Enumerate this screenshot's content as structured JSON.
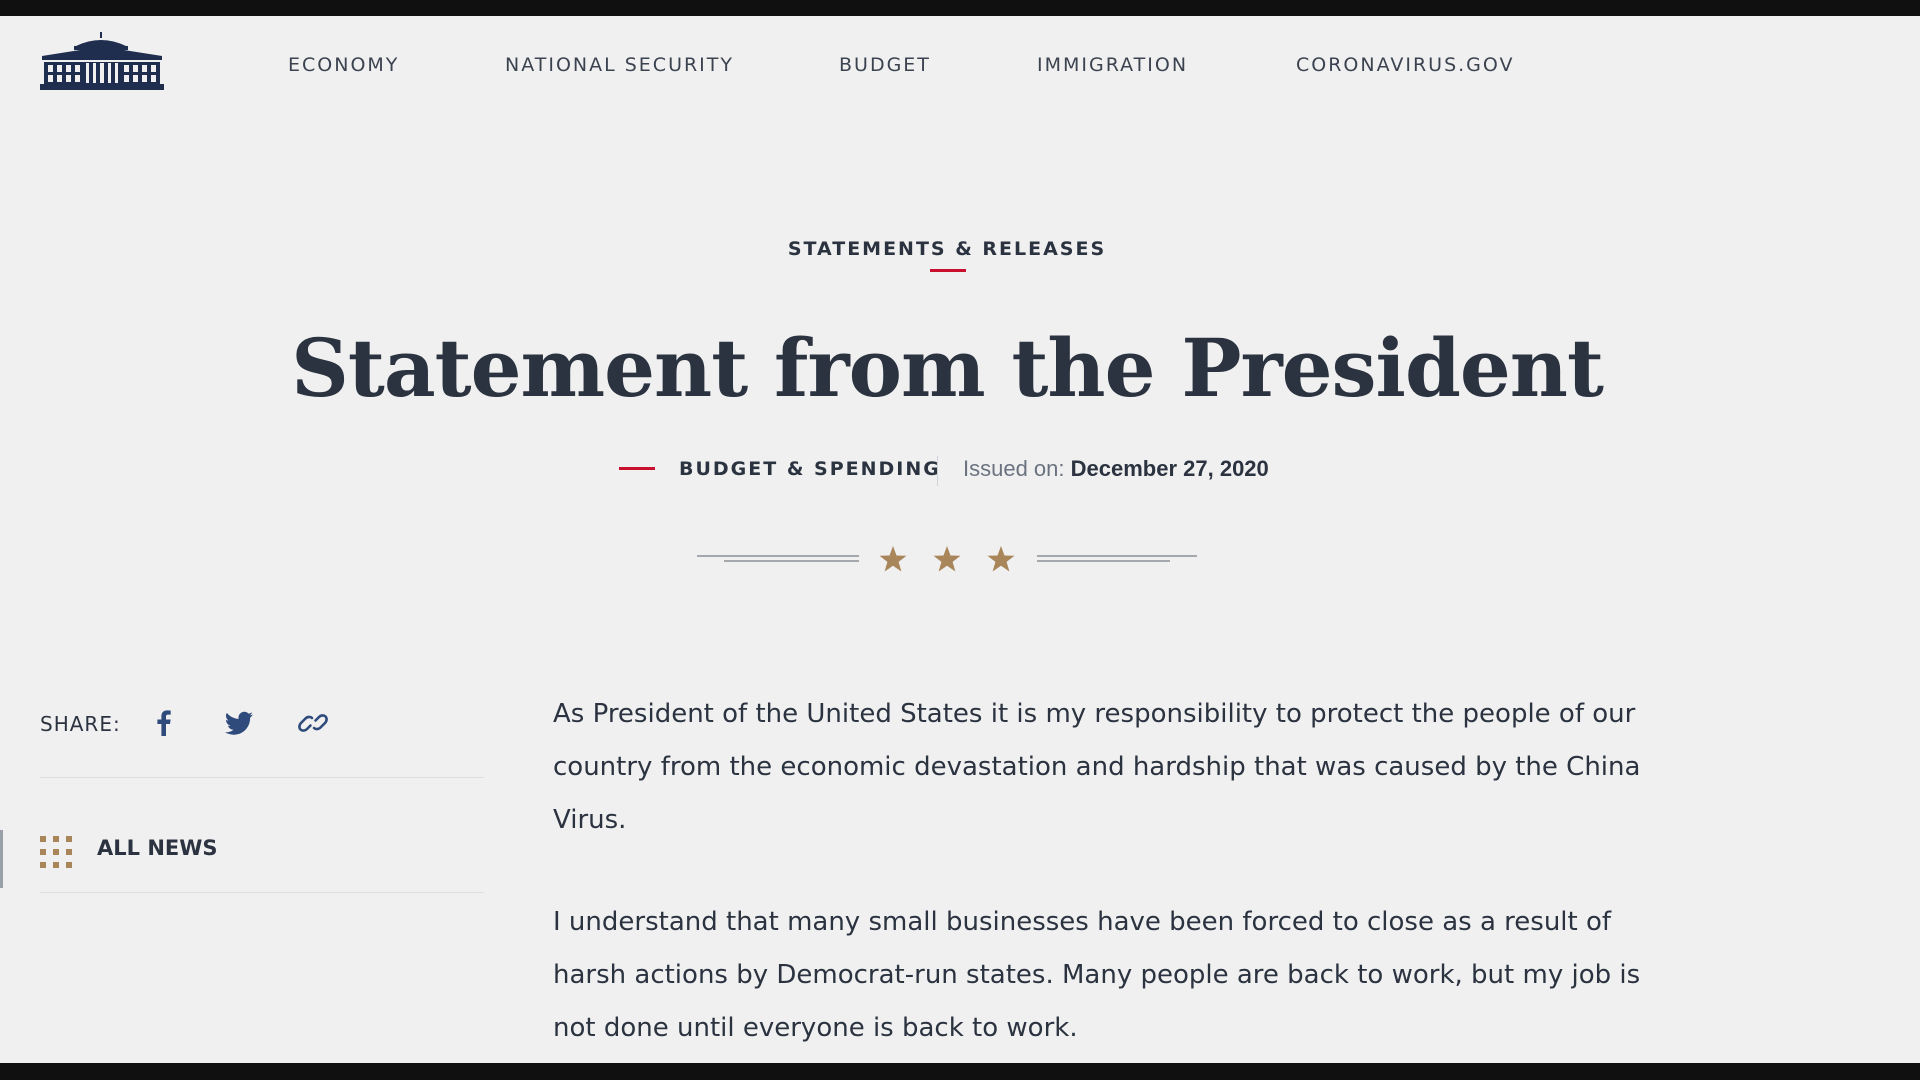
{
  "nav": {
    "items": [
      "ECONOMY",
      "NATIONAL SECURITY",
      "BUDGET",
      "IMMIGRATION",
      "CORONAVIRUS.GOV"
    ]
  },
  "article": {
    "eyebrow": "STATEMENTS & RELEASES",
    "title": "Statement from the President",
    "category": "BUDGET & SPENDING",
    "issued_label": "Issued on: ",
    "issued_date": "December 27, 2020",
    "paragraphs": [
      "As President of the United States it is my responsibility to protect the people of our country from the economic devastation and hardship that was caused by the China Virus.",
      "I understand that many small businesses have been forced to close as a result of harsh actions by Democrat-run states. Many people are back to work, but my job is not done until everyone is back to work."
    ]
  },
  "sidebar": {
    "share_label": "SHARE:",
    "share_icons": [
      "facebook-icon",
      "twitter-icon",
      "link-icon"
    ],
    "all_news_label": "ALL NEWS"
  },
  "colors": {
    "accent_red": "#c8102e",
    "star_gold": "#a9865a",
    "text_dark": "#2b3340",
    "logo_navy": "#1f2d4f",
    "share_blue": "#2f4b7c"
  }
}
